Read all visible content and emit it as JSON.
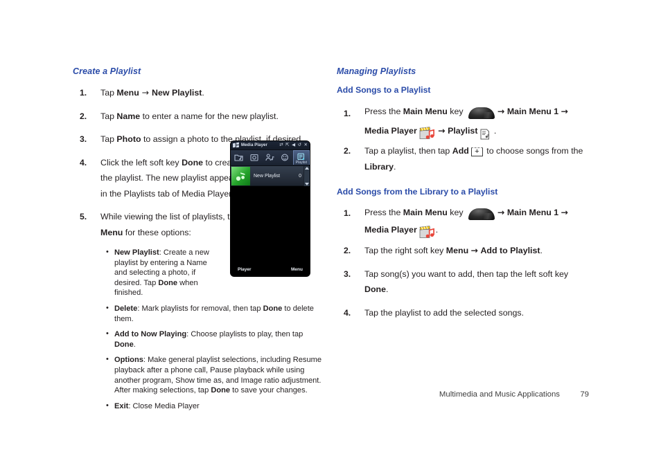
{
  "document": {
    "footer_text": "Multimedia and Music Applications",
    "page_number": "79"
  },
  "colors": {
    "heading_blue": "#2a4ba8",
    "body_text": "#231f20"
  },
  "left_column": {
    "section_heading": "Create a Playlist",
    "steps": [
      {
        "num": "1.",
        "text_parts": [
          "Tap ",
          "Menu",
          " → ",
          "New Playlist",
          "."
        ]
      },
      {
        "num": "2.",
        "text_parts": [
          "Tap ",
          "Name",
          " to enter a name for the new playlist."
        ]
      },
      {
        "num": "3.",
        "text_parts": [
          "Tap ",
          "Photo",
          " to assign a photo to the playlist, if desired."
        ]
      },
      {
        "num": "4.",
        "text_parts": [
          "Click the left soft key ",
          "Done",
          " to create the playlist. The new playlist appears in the Playlists tab of Media Player."
        ]
      },
      {
        "num": "5.",
        "text_parts": [
          "While viewing the list of playlists, tap ",
          "Menu",
          " for these options:"
        ]
      }
    ],
    "bullets": [
      {
        "term": "New Playlist",
        "rest": ": Create a new playlist by entering a Name and selecting a photo, if desired. Tap ",
        "bold2": "Done",
        "tail": " when finished."
      },
      {
        "term": "Delete",
        "rest": ": Mark playlists for removal, then tap ",
        "bold2": "Done",
        "tail": " to delete them."
      },
      {
        "term": "Add to Now Playing",
        "rest": ": Choose playlists to play, then tap ",
        "bold2": "Done",
        "tail": "."
      },
      {
        "term": "Options",
        "rest": ": Make general playlist selections, including Resume playback after a phone call, Pause playback while using another program, Show time as, and Image ratio adjustment. After making selections, tap ",
        "bold2": "Done",
        "tail": " to save your changes."
      },
      {
        "term": "Exit",
        "rest": ": Close Media Player",
        "bold2": "",
        "tail": ""
      }
    ]
  },
  "phone_screenshot": {
    "title": "Media Player",
    "titlebar_icons": [
      "sync-icon",
      "connection-icon",
      "volume-icon",
      "rotate-icon",
      "close-icon"
    ],
    "tabs": [
      {
        "name": "folder-music-icon",
        "selected": false
      },
      {
        "name": "photo-icon",
        "selected": false
      },
      {
        "name": "artist-music-icon",
        "selected": false
      },
      {
        "name": "genre-icon",
        "selected": false
      },
      {
        "name": "playlist-icon",
        "selected": true,
        "label": "Playlist"
      }
    ],
    "list_item": {
      "name": "New Playlist",
      "count": "0"
    },
    "softkeys": {
      "left": "Player",
      "right": "Menu"
    }
  },
  "right_column": {
    "section_heading": "Managing Playlists",
    "sub_heading_1": "Add Songs to a Playlist",
    "sub_heading_2": "Add Songs from the Library to a Playlist",
    "group1": {
      "step1": {
        "num": "1.",
        "t1": "Press the ",
        "b1": "Main Menu",
        "t2": " key ",
        "a1": "→",
        "b2": "Main Menu 1",
        "a2": "→",
        "b3": "Media Player",
        "a3": "→",
        "b4": "Playlist",
        "t3": "."
      },
      "step2": {
        "num": "2.",
        "t1": "Tap a playlist, then tap ",
        "b1": "Add",
        "icon": "+",
        "t2": " to choose songs from the ",
        "b2": "Library",
        "t3": "."
      }
    },
    "group2": {
      "step1": {
        "num": "1.",
        "t1": "Press the ",
        "b1": "Main Menu",
        "t2": " key ",
        "a1": "→",
        "b2": "Main Menu 1",
        "a2": "→",
        "b3": "Media Player",
        "t3": "."
      },
      "step2": {
        "num": "2.",
        "t1": "Tap the right soft key ",
        "b1": "Menu",
        "a1": "→",
        "b2": "Add to Playlist",
        "t2": "."
      },
      "step3": {
        "num": "3.",
        "t1": "Tap song(s) you want to add, then tap the left soft key ",
        "b1": "Done",
        "t2": "."
      },
      "step4": {
        "num": "4.",
        "t1": "Tap the playlist to add the selected songs."
      }
    }
  }
}
